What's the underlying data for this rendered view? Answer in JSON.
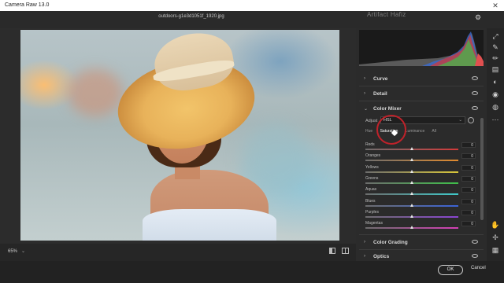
{
  "window": {
    "title": "Camera Raw 13.0",
    "close_glyph": "✕"
  },
  "header": {
    "filename": "outdoors-g1e3d1051f_1920.jpg",
    "watermark": "Artifact Hafiz"
  },
  "canvas": {
    "zoom": "65%",
    "zoom_caret": "⌄"
  },
  "panel": {
    "sections": [
      {
        "label": "Curve",
        "chevron": "›"
      },
      {
        "label": "Detail",
        "chevron": "›"
      },
      {
        "label": "Color Mixer",
        "chevron": "⌄"
      },
      {
        "label": "Color Grading",
        "chevron": "›"
      },
      {
        "label": "Optics",
        "chevron": "›"
      }
    ],
    "color_mixer": {
      "adjust_label": "Adjust",
      "adjust_value": "HSL",
      "adjust_caret": "⌄",
      "tabs": [
        "Hue",
        "Saturation",
        "Luminance",
        "All"
      ],
      "active_tab": "Saturation",
      "sliders": [
        {
          "name": "Reds",
          "value": "0",
          "position": 0.5,
          "track": "linear-gradient(90deg,#6d6d6d,#d23a3a)"
        },
        {
          "name": "Oranges",
          "value": "0",
          "position": 0.5,
          "track": "linear-gradient(90deg,#6d6d6d,#e08a2e)"
        },
        {
          "name": "Yellows",
          "value": "0",
          "position": 0.5,
          "track": "linear-gradient(90deg,#6d6d6d,#d8c63a)"
        },
        {
          "name": "Greens",
          "value": "0",
          "position": 0.5,
          "track": "linear-gradient(90deg,#6d6d6d,#3fbf4a)"
        },
        {
          "name": "Aquas",
          "value": "0",
          "position": 0.5,
          "track": "linear-gradient(90deg,#6d6d6d,#3fc9c9)"
        },
        {
          "name": "Blues",
          "value": "0",
          "position": 0.5,
          "track": "linear-gradient(90deg,#6d6d6d,#3b63d6)"
        },
        {
          "name": "Purples",
          "value": "0",
          "position": 0.5,
          "track": "linear-gradient(90deg,#6d6d6d,#8a45d2)"
        },
        {
          "name": "Magentas",
          "value": "0",
          "position": 0.5,
          "track": "linear-gradient(90deg,#6d6d6d,#d43fb5)"
        }
      ]
    }
  },
  "toolbar": {
    "icons": [
      "expand-icon",
      "brush-icon",
      "heal-icon",
      "gradient-icon",
      "redeye-icon",
      "presets-icon",
      "more-icon",
      "hand-icon",
      "sampler-icon",
      "grid-icon"
    ]
  },
  "footer": {
    "ok_label": "OK",
    "cancel_label": "Cancel"
  },
  "colors": {
    "accent_ring": "#c0222a",
    "panel_bg": "#2b2b2b"
  }
}
